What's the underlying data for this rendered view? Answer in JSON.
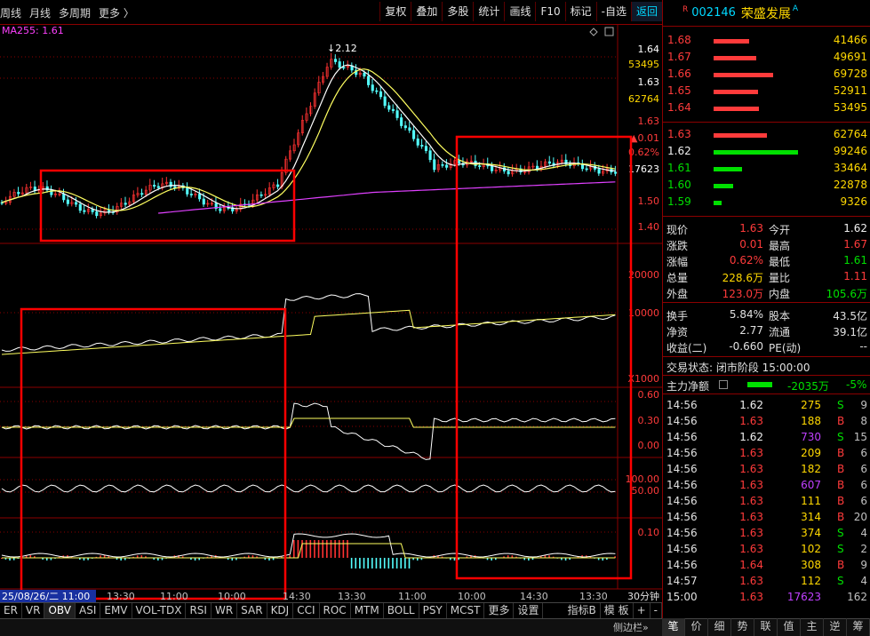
{
  "toolbar": {
    "left": [
      "周线",
      "月线",
      "多周期",
      "更多 〉"
    ],
    "right": [
      "复权",
      "叠加",
      "多股",
      "统计",
      "画线",
      "F10",
      "标记",
      "-自选",
      "返回"
    ]
  },
  "chart": {
    "ma_label": "MA255: 1.61",
    "peak_label": "2.12",
    "price_axis": [
      "1.64",
      "53495",
      "1.63",
      "62764",
      "1.63",
      "▲0.01",
      "0.62%",
      "17623",
      "1.50",
      "1.40"
    ],
    "vol_axis": [
      "20000",
      "10000",
      "X1000"
    ],
    "ind1_axis": [
      "0.60",
      "0.30",
      "0.00"
    ],
    "ind2_axis": [
      "100.00",
      "50.00"
    ],
    "ind3_axis": [
      "0.10"
    ],
    "time_axis": [
      "25/08/26/二 11:00",
      "13:30",
      "11:00",
      "10:00",
      "14:30",
      "13:30",
      "11:00",
      "10:00",
      "14:30",
      "13:30"
    ],
    "period": "30分钟",
    "colors": {
      "up": "#ff3232",
      "down": "#54ffff",
      "ma": "#ffff60",
      "ma255": "#e040ff",
      "highlight": "#ff0000"
    }
  },
  "tabs": [
    "ER",
    "VR",
    "OBV",
    "ASI",
    "EMV",
    "VOL-TDX",
    "RSI",
    "WR",
    "SAR",
    "KDJ",
    "CCI",
    "ROC",
    "MTM",
    "BOLL",
    "PSY",
    "MCST",
    "更多",
    "设置"
  ],
  "tabs_right": [
    "指标B",
    "模 板",
    "+",
    "-"
  ],
  "sidebar_btn": "侧边栏»",
  "stock": {
    "marker": "R",
    "code": "002146",
    "name": "荣盛发展",
    "suffix": "A"
  },
  "asks": [
    {
      "price": "1.68",
      "vol": "41466",
      "pct": 0.42
    },
    {
      "price": "1.67",
      "vol": "49691",
      "pct": 0.5
    },
    {
      "price": "1.66",
      "vol": "69728",
      "pct": 0.7
    },
    {
      "price": "1.65",
      "vol": "52911",
      "pct": 0.53
    },
    {
      "price": "1.64",
      "vol": "53495",
      "pct": 0.54
    }
  ],
  "bids": [
    {
      "price": "1.63",
      "vol": "62764",
      "pct": 0.63,
      "color": "red"
    },
    {
      "price": "1.62",
      "vol": "99246",
      "pct": 1.0,
      "color": "green"
    },
    {
      "price": "1.61",
      "vol": "33464",
      "pct": 0.34,
      "color": "green"
    },
    {
      "price": "1.60",
      "vol": "22878",
      "pct": 0.23,
      "color": "green"
    },
    {
      "price": "1.59",
      "vol": "9326",
      "pct": 0.09,
      "color": "green"
    }
  ],
  "quote": [
    {
      "k1": "现价",
      "v1": "1.63",
      "c1": "red",
      "k2": "今开",
      "v2": "1.62",
      "c2": "white"
    },
    {
      "k1": "涨跌",
      "v1": "0.01",
      "c1": "red",
      "k2": "最高",
      "v2": "1.67",
      "c2": "red"
    },
    {
      "k1": "涨幅",
      "v1": "0.62%",
      "c1": "red",
      "k2": "最低",
      "v2": "1.61",
      "c2": "green"
    },
    {
      "k1": "总量",
      "v1": "228.6万",
      "c1": "yellow",
      "k2": "量比",
      "v2": "1.11",
      "c2": "red"
    },
    {
      "k1": "外盘",
      "v1": "123.0万",
      "c1": "red",
      "k2": "内盘",
      "v2": "105.6万",
      "c2": "green"
    }
  ],
  "quote2": [
    {
      "k1": "换手",
      "v1": "5.84%",
      "k2": "股本",
      "v2": "43.5亿"
    },
    {
      "k1": "净资",
      "v1": "2.77",
      "k2": "流通",
      "v2": "39.1亿"
    },
    {
      "k1": "收益(二)",
      "v1": "-0.660",
      "k2": "PE(动)",
      "v2": "--"
    }
  ],
  "status": "交易状态: 闭市阶段 15:00:00",
  "net": {
    "label": "主力净额",
    "value": "-2035万",
    "pct": "-5%"
  },
  "trades": [
    {
      "t": "14:56",
      "p": "1.62",
      "pc": "white",
      "v": "275",
      "vc": "yellow",
      "bs": "S",
      "n": "9"
    },
    {
      "t": "14:56",
      "p": "1.63",
      "pc": "red",
      "v": "188",
      "vc": "yellow",
      "bs": "B",
      "n": "8"
    },
    {
      "t": "14:56",
      "p": "1.62",
      "pc": "white",
      "v": "730",
      "vc": "purple",
      "bs": "S",
      "n": "15"
    },
    {
      "t": "14:56",
      "p": "1.63",
      "pc": "red",
      "v": "209",
      "vc": "yellow",
      "bs": "B",
      "n": "6"
    },
    {
      "t": "14:56",
      "p": "1.63",
      "pc": "red",
      "v": "182",
      "vc": "yellow",
      "bs": "B",
      "n": "6"
    },
    {
      "t": "14:56",
      "p": "1.63",
      "pc": "red",
      "v": "607",
      "vc": "purple",
      "bs": "B",
      "n": "6"
    },
    {
      "t": "14:56",
      "p": "1.63",
      "pc": "red",
      "v": "111",
      "vc": "yellow",
      "bs": "B",
      "n": "6"
    },
    {
      "t": "14:56",
      "p": "1.63",
      "pc": "red",
      "v": "314",
      "vc": "yellow",
      "bs": "B",
      "n": "20"
    },
    {
      "t": "14:56",
      "p": "1.63",
      "pc": "red",
      "v": "374",
      "vc": "yellow",
      "bs": "S",
      "n": "4"
    },
    {
      "t": "14:56",
      "p": "1.63",
      "pc": "red",
      "v": "102",
      "vc": "yellow",
      "bs": "S",
      "n": "2"
    },
    {
      "t": "14:56",
      "p": "1.64",
      "pc": "red",
      "v": "308",
      "vc": "yellow",
      "bs": "B",
      "n": "9"
    },
    {
      "t": "14:57",
      "p": "1.63",
      "pc": "red",
      "v": "112",
      "vc": "yellow",
      "bs": "S",
      "n": "4"
    },
    {
      "t": "15:00",
      "p": "1.63",
      "pc": "red",
      "v": "17623",
      "vc": "purple",
      "bs": "",
      "n": "162"
    }
  ],
  "right_tabs": [
    "笔",
    "价",
    "细",
    "势",
    "联",
    "值",
    "主",
    "逆",
    "筹"
  ]
}
